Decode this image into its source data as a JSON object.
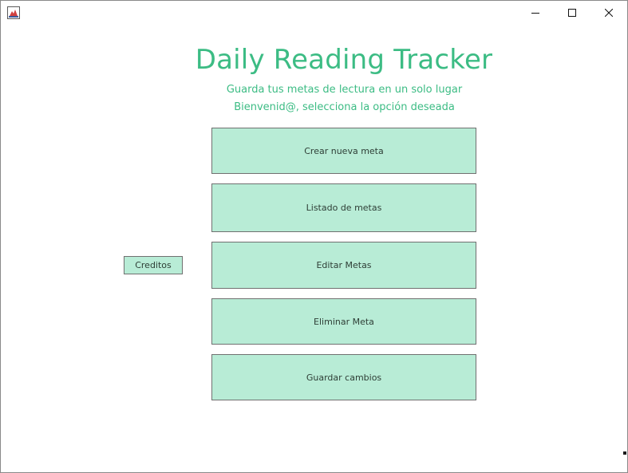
{
  "window": {
    "icon": "java-app-icon",
    "controls": [
      "minimize-icon",
      "maximize-icon",
      "close-icon"
    ]
  },
  "header": {
    "title": "Daily Reading Tracker",
    "subtitle": "Guarda tus metas de lectura en un solo lugar",
    "welcome": "Bienvenid@, selecciona la opción deseada"
  },
  "menu": {
    "create": "Crear nueva meta",
    "list": "Listado de metas",
    "edit": "Editar Metas",
    "delete": "Eliminar Meta",
    "save": "Guardar cambios"
  },
  "credits": "Creditos",
  "colors": {
    "accent": "#3cbc84",
    "button_bg": "#b8ecd6",
    "button_border": "#707070"
  }
}
